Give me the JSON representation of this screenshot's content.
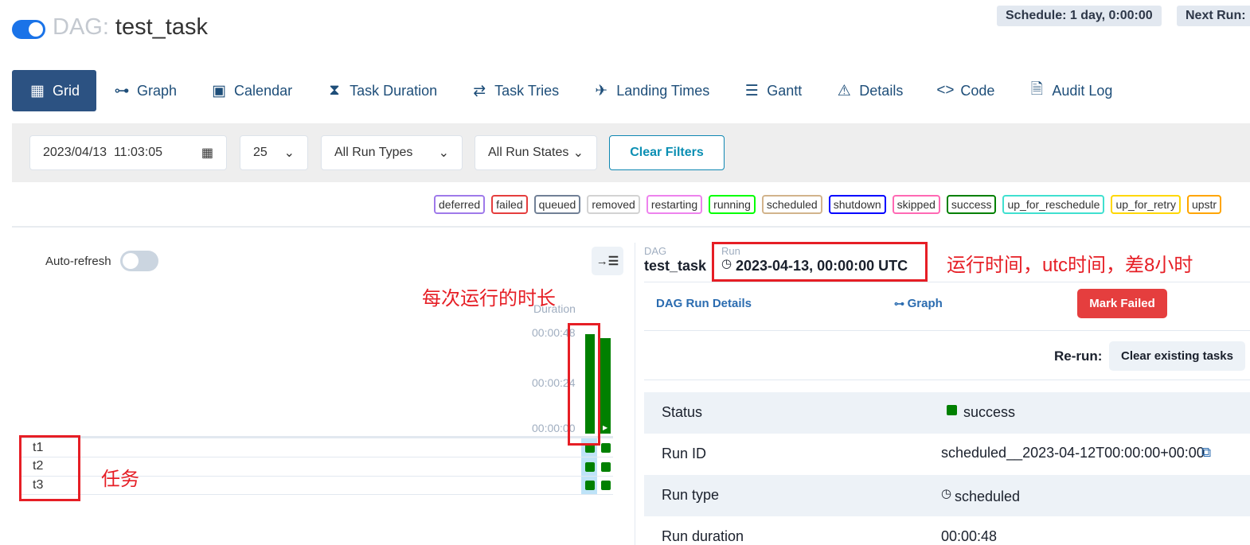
{
  "header": {
    "dag_prefix": "DAG:",
    "dag_id": "test_task",
    "schedule": "Schedule: 1 day, 0:00:00",
    "next_run": "Next Run:"
  },
  "nav": {
    "tabs": [
      {
        "label": "Grid",
        "icon": "grid-icon"
      },
      {
        "label": "Graph",
        "icon": "graph-icon"
      },
      {
        "label": "Calendar",
        "icon": "calendar-icon"
      },
      {
        "label": "Task Duration",
        "icon": "hourglass-icon"
      },
      {
        "label": "Task Tries",
        "icon": "retry-icon"
      },
      {
        "label": "Landing Times",
        "icon": "plane-landing-icon"
      },
      {
        "label": "Gantt",
        "icon": "gantt-icon"
      },
      {
        "label": "Details",
        "icon": "warning-triangle-icon"
      },
      {
        "label": "Code",
        "icon": "code-icon"
      },
      {
        "label": "Audit Log",
        "icon": "search-document-icon"
      }
    ]
  },
  "filters": {
    "base_date": "2023/04/13  11:03:05",
    "num_runs": "25",
    "run_types": "All Run Types",
    "run_states": "All Run States",
    "clear_label": "Clear Filters"
  },
  "states": [
    {
      "label": "deferred",
      "color": "#9f7aea"
    },
    {
      "label": "failed",
      "color": "#e53e3e"
    },
    {
      "label": "queued",
      "color": "#718096"
    },
    {
      "label": "removed",
      "color": "#d3d3d3"
    },
    {
      "label": "restarting",
      "color": "#ee82ee"
    },
    {
      "label": "running",
      "color": "#00ff00"
    },
    {
      "label": "scheduled",
      "color": "#d2b48c"
    },
    {
      "label": "shutdown",
      "color": "#0000ff"
    },
    {
      "label": "skipped",
      "color": "#ff69b4"
    },
    {
      "label": "success",
      "color": "#008000"
    },
    {
      "label": "up_for_reschedule",
      "color": "#40e0d0"
    },
    {
      "label": "up_for_retry",
      "color": "#ffd700"
    },
    {
      "label": "upstr",
      "color": "#ffa500"
    }
  ],
  "grid": {
    "auto_refresh": "Auto-refresh",
    "collapse_icon": "→☰",
    "duration_label": "Duration",
    "ticks": [
      "00:00:48",
      "00:00:24",
      "00:00:00"
    ],
    "tasks": [
      "t1",
      "t2",
      "t3"
    ]
  },
  "annotations": {
    "duration_note": "每次运行的时长",
    "tasks_note": "任务",
    "time_note": "运行时间，utc时间，差8小时"
  },
  "details": {
    "dag_label": "DAG",
    "dag_id": "test_task",
    "run_label": "Run",
    "run_time": "2023-04-13, 00:00:00 UTC",
    "links": {
      "run_details": "DAG Run Details",
      "graph": "Graph"
    },
    "mark_failed": "Mark Failed",
    "rerun_label": "Re-run:",
    "clear_tasks": "Clear existing tasks",
    "rows": [
      {
        "key": "Status",
        "value": "success"
      },
      {
        "key": "Run ID",
        "value": "scheduled__2023-04-12T00:00:00+00:00"
      },
      {
        "key": "Run type",
        "value": "scheduled"
      },
      {
        "key": "Run duration",
        "value": "00:00:48"
      }
    ]
  },
  "colors": {
    "accent": "#2c5282",
    "success": "#008000",
    "annotation": "#e61e25"
  }
}
